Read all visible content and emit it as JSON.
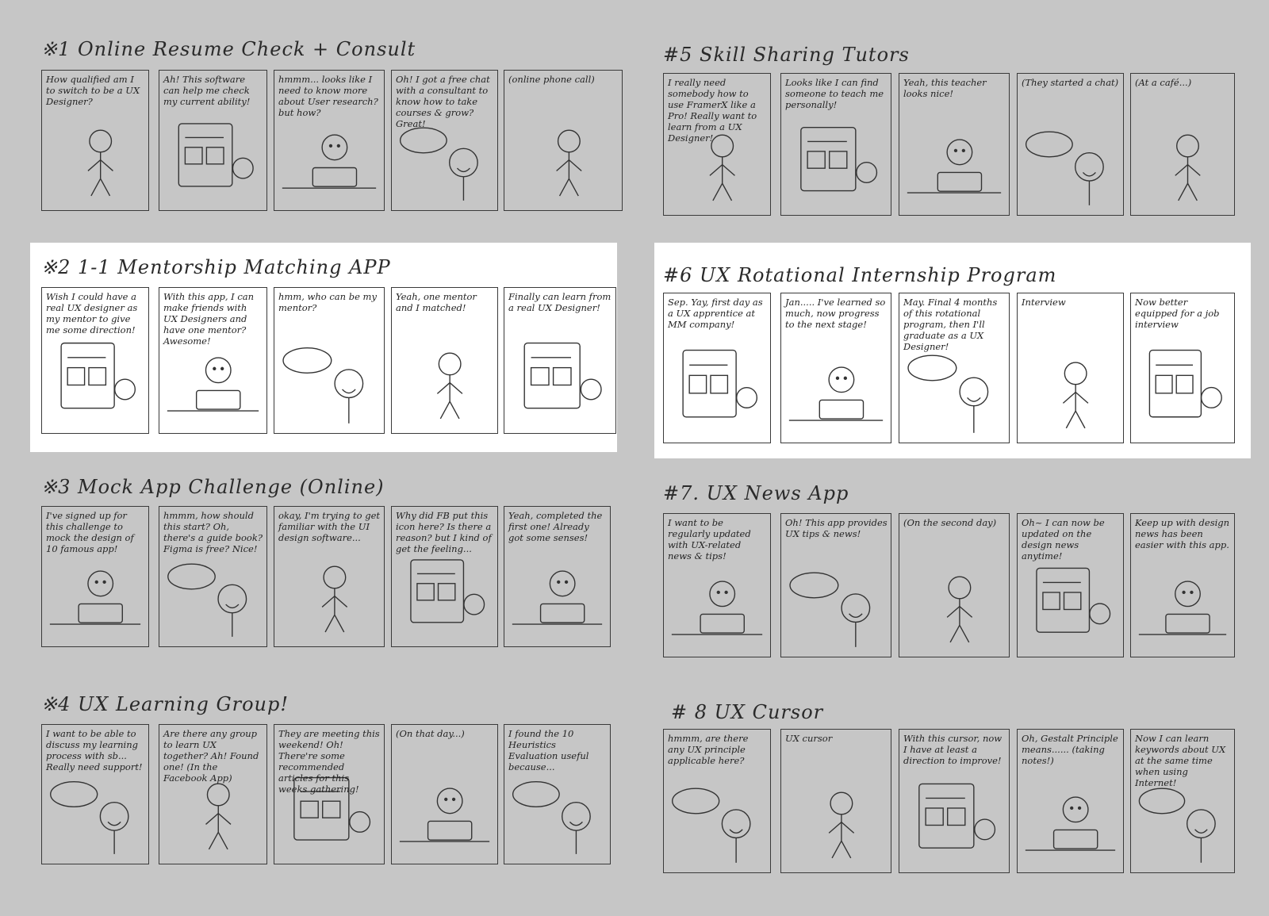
{
  "storyboards": [
    {
      "id": 1,
      "title": "※1 Online Resume Check + Consult",
      "panels": [
        "How qualified am I to switch to be a UX Designer?",
        "Ah! This software can help me check my current ability!",
        "hmmm... looks like I need to know more about User research? but how?",
        "Oh! I got a free chat with a consultant to know how to take courses & grow? Great!",
        "(online phone call)"
      ]
    },
    {
      "id": 2,
      "title": "※2 1-1 Mentorship Matching APP",
      "panels": [
        "Wish I could have a real UX designer as my mentor to give me some direction!",
        "With this app, I can make friends with UX Designers and have one mentor? Awesome!",
        "hmm, who can be my mentor?",
        "Yeah, one mentor and I matched!",
        "Finally can learn from a real UX Designer!"
      ]
    },
    {
      "id": 3,
      "title": "※3 Mock App Challenge (Online)",
      "panels": [
        "I've signed up for this challenge to mock the design of 10 famous app!",
        "hmmm, how should this start? Oh, there's a guide book? Figma is free? Nice!",
        "okay, I'm trying to get familiar with the UI design software...",
        "Why did FB put this icon here? Is there a reason? but I kind of get the feeling...",
        "Yeah, completed the first one! Already got some senses!"
      ]
    },
    {
      "id": 4,
      "title": "※4 UX Learning Group!",
      "panels": [
        "I want to be able to discuss my learning process with sb... Really need support!",
        "Are there any group to learn UX together? Ah! Found one! (In the Facebook App)",
        "They are meeting this weekend! Oh! There're some recommended articles for this weeks gathering!",
        "(On that day...)",
        "I found the 10 Heuristics Evaluation useful because..."
      ]
    },
    {
      "id": 5,
      "title": "#5 Skill Sharing Tutors",
      "panels": [
        "I really need somebody how to use FramerX like a Pro! Really want to learn from a UX Designer!",
        "Looks like I can find someone to teach me personally!",
        "Yeah, this teacher looks nice!",
        "(They started a chat)",
        "(At a café...)"
      ]
    },
    {
      "id": 6,
      "title": "#6 UX Rotational Internship Program",
      "panels": [
        "Sep. Yay, first day as a UX apprentice at MM company!",
        "Jan..... I've learned so much, now progress to the next stage!",
        "May. Final 4 months of this rotational program, then I'll graduate as a UX Designer!",
        "Interview",
        "Now better equipped for a job interview"
      ]
    },
    {
      "id": 7,
      "title": "#7. UX News App",
      "panels": [
        "I want to be regularly updated with UX-related news & tips!",
        "Oh! This app provides UX tips & news!",
        "(On the second day)",
        "Oh~ I can now be updated on the design news anytime!",
        "Keep up with design news has been easier with this app."
      ]
    },
    {
      "id": 8,
      "title": "# 8 UX Cursor",
      "panels": [
        "hmmm, are there any UX principle applicable here?",
        "UX cursor",
        "With this cursor, now I have at least a direction to improve!",
        "Oh, Gestalt Principle means...... (taking notes!)",
        "Now I can learn keywords about UX at the same time when using Internet!"
      ]
    }
  ],
  "highlighted": [
    2,
    6
  ]
}
